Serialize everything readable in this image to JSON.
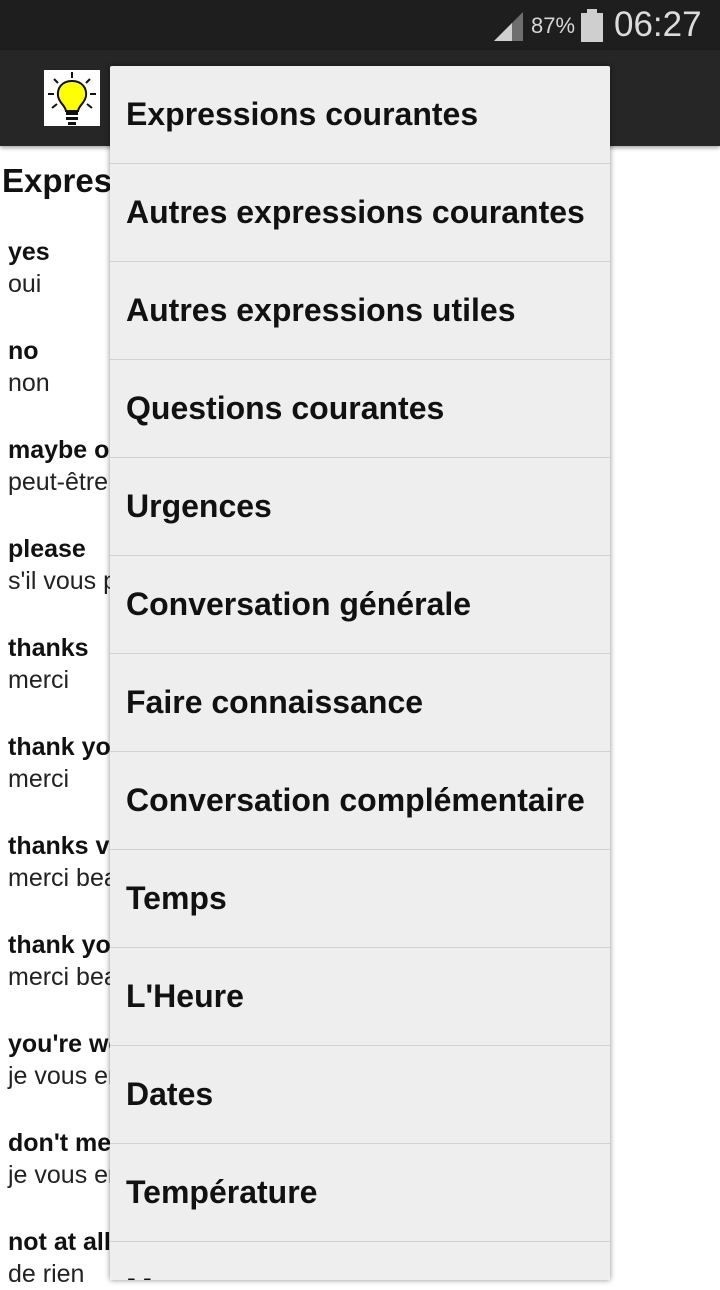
{
  "status_bar": {
    "battery_percent": "87%",
    "time": "06:27"
  },
  "page": {
    "title": "Expressions courantes"
  },
  "phrases": [
    {
      "en": "yes",
      "fr": "oui"
    },
    {
      "en": "no",
      "fr": "non"
    },
    {
      "en": "maybe or perhaps",
      "fr": "peut-être"
    },
    {
      "en": "please",
      "fr": "s'il vous plaît"
    },
    {
      "en": "thanks",
      "fr": "merci"
    },
    {
      "en": "thank you",
      "fr": "merci"
    },
    {
      "en": "thanks very much",
      "fr": "merci beaucoup"
    },
    {
      "en": "thank you very much",
      "fr": "merci beaucoup"
    },
    {
      "en": "you're welcome",
      "fr": "je vous en prie"
    },
    {
      "en": "don't mention it",
      "fr": "je vous en prie"
    },
    {
      "en": "not at all",
      "fr": "de rien"
    }
  ],
  "menu": {
    "items": [
      "Expressions courantes",
      "Autres expressions courantes",
      "Autres expressions utiles",
      "Questions courantes",
      "Urgences",
      "Conversation générale",
      "Faire connaissance",
      "Conversation complémentaire",
      "Temps",
      "L'Heure",
      "Dates",
      "Température",
      "Mesures"
    ]
  },
  "icons": {
    "app": "lightbulb-icon",
    "signal": "signal-icon",
    "battery": "battery-icon"
  },
  "colors": {
    "status_bar": "#1e1e1e",
    "action_bar": "#262626",
    "menu_background": "#eeeeee",
    "bulb": "#ffff00"
  }
}
